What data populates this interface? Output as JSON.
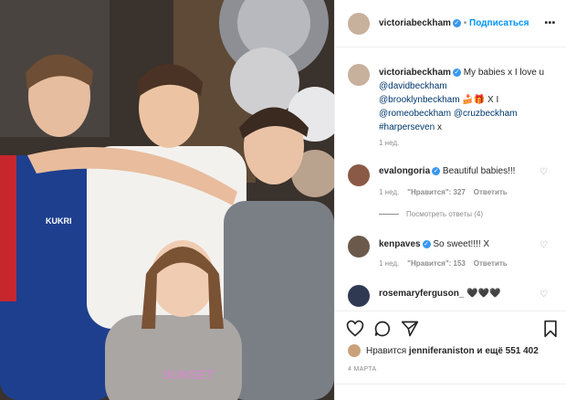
{
  "header": {
    "username": "victoriabeckham",
    "follow_label": "Подписаться",
    "dot": "•",
    "more": "⋮"
  },
  "caption": {
    "username": "victoriabeckham",
    "text_pre": "My babies x I love u",
    "mentions": [
      "@davidbeckham",
      "@brooklynbeckham",
      "@romeobeckham",
      "@cruzbeckham",
      "#harperseven"
    ],
    "emoji": "🍰🎁",
    "text_mid": "X I",
    "text_end": "x",
    "time": "1 нед."
  },
  "comments": [
    {
      "username": "evalongoria",
      "verified": true,
      "text": "Beautiful babies!!!",
      "time": "1 нед.",
      "likes": "\"Нравится\": 327",
      "reply": "Ответить"
    },
    {
      "username": "kenpaves",
      "verified": true,
      "text": "So sweet!!!! X",
      "time": "1 нед.",
      "likes": "\"Нравится\": 153",
      "reply": "Ответить"
    },
    {
      "username": "rosemaryferguson_",
      "verified": false,
      "text": "🖤🖤🖤"
    }
  ],
  "view_replies": "Посмотреть ответы (4)",
  "likes_line": {
    "prefix": "Нравится",
    "user": "jenniferaniston",
    "suffix": "и ещё 551 402"
  },
  "date": "4 МАРТА",
  "icons": {
    "like": "heart-icon",
    "comment": "comment-icon",
    "share": "share-icon",
    "save": "bookmark-icon"
  },
  "colors": {
    "link": "#0095f6",
    "verified": "#3897f0",
    "text": "#262626",
    "meta": "#8e8e8e"
  }
}
